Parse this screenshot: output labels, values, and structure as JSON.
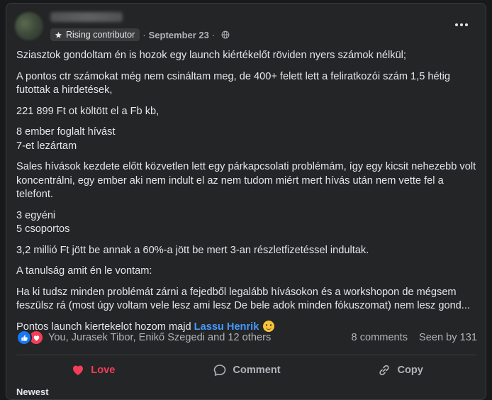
{
  "post": {
    "badge_label": "Rising contributor",
    "date": "September 23",
    "meta_separator": "·",
    "paragraphs": [
      "Sziasztok gondoltam én is hozok egy launch kiértékelőt röviden nyers számok nélkül;",
      "A pontos ctr számokat még nem csináltam meg, de 400+ felett lett a feliratkozói szám 1,5 hétig futottak a hirdetések,",
      "221 899 Ft ot költött el a Fb kb,",
      "8 ember foglalt hívást",
      "7-et lezártam",
      "Sales hívások kezdete előtt közvetlen lett egy párkapcsolati problémám, így egy kicsit nehezebb volt koncentrálni, egy ember aki nem indult el az nem tudom miért mert hívás után nem vette fel a telefont.",
      "3 egyéni",
      "5 csoportos",
      "3,2 millió Ft jött be annak a 60%-a jött be mert 3-an részletfizetéssel indultak.",
      "A tanulság amit én le vontam:",
      "Ha ki tudsz minden problémát zárni a fejedből legalább hívásokon és a workshopon de mégsem feszülsz rá (most úgy voltam vele lesz ami lesz De bele adok minden fókuszomat) nem lesz gond...",
      "Pontos launch kiertekelot hozom majd"
    ],
    "mention": "Lassu Henrik"
  },
  "reactions": {
    "names": "You, Jurasek Tibor, Enikő Szegedi and 12 others",
    "comments": "8 comments",
    "seen_by": "Seen by 131"
  },
  "actions": {
    "love_label": "Love",
    "comment_label": "Comment",
    "copy_label": "Copy"
  },
  "next_section_peek": "Newest",
  "icons": {
    "badge": "star-icon",
    "privacy": "globe-icon",
    "more": "more-options-icon",
    "like_reaction": "like-reaction-icon",
    "love_reaction": "love-reaction-icon",
    "love_action": "heart-icon",
    "comment_action": "comment-icon",
    "copy_action": "link-icon",
    "emoji": "smiling-face-icon"
  },
  "colors": {
    "background": "#18191a",
    "card": "#242526",
    "text_primary": "#e4e6eb",
    "text_secondary": "#b0b3b8",
    "mention": "#4599ff",
    "love": "#f33e58",
    "like": "#1877f2"
  }
}
